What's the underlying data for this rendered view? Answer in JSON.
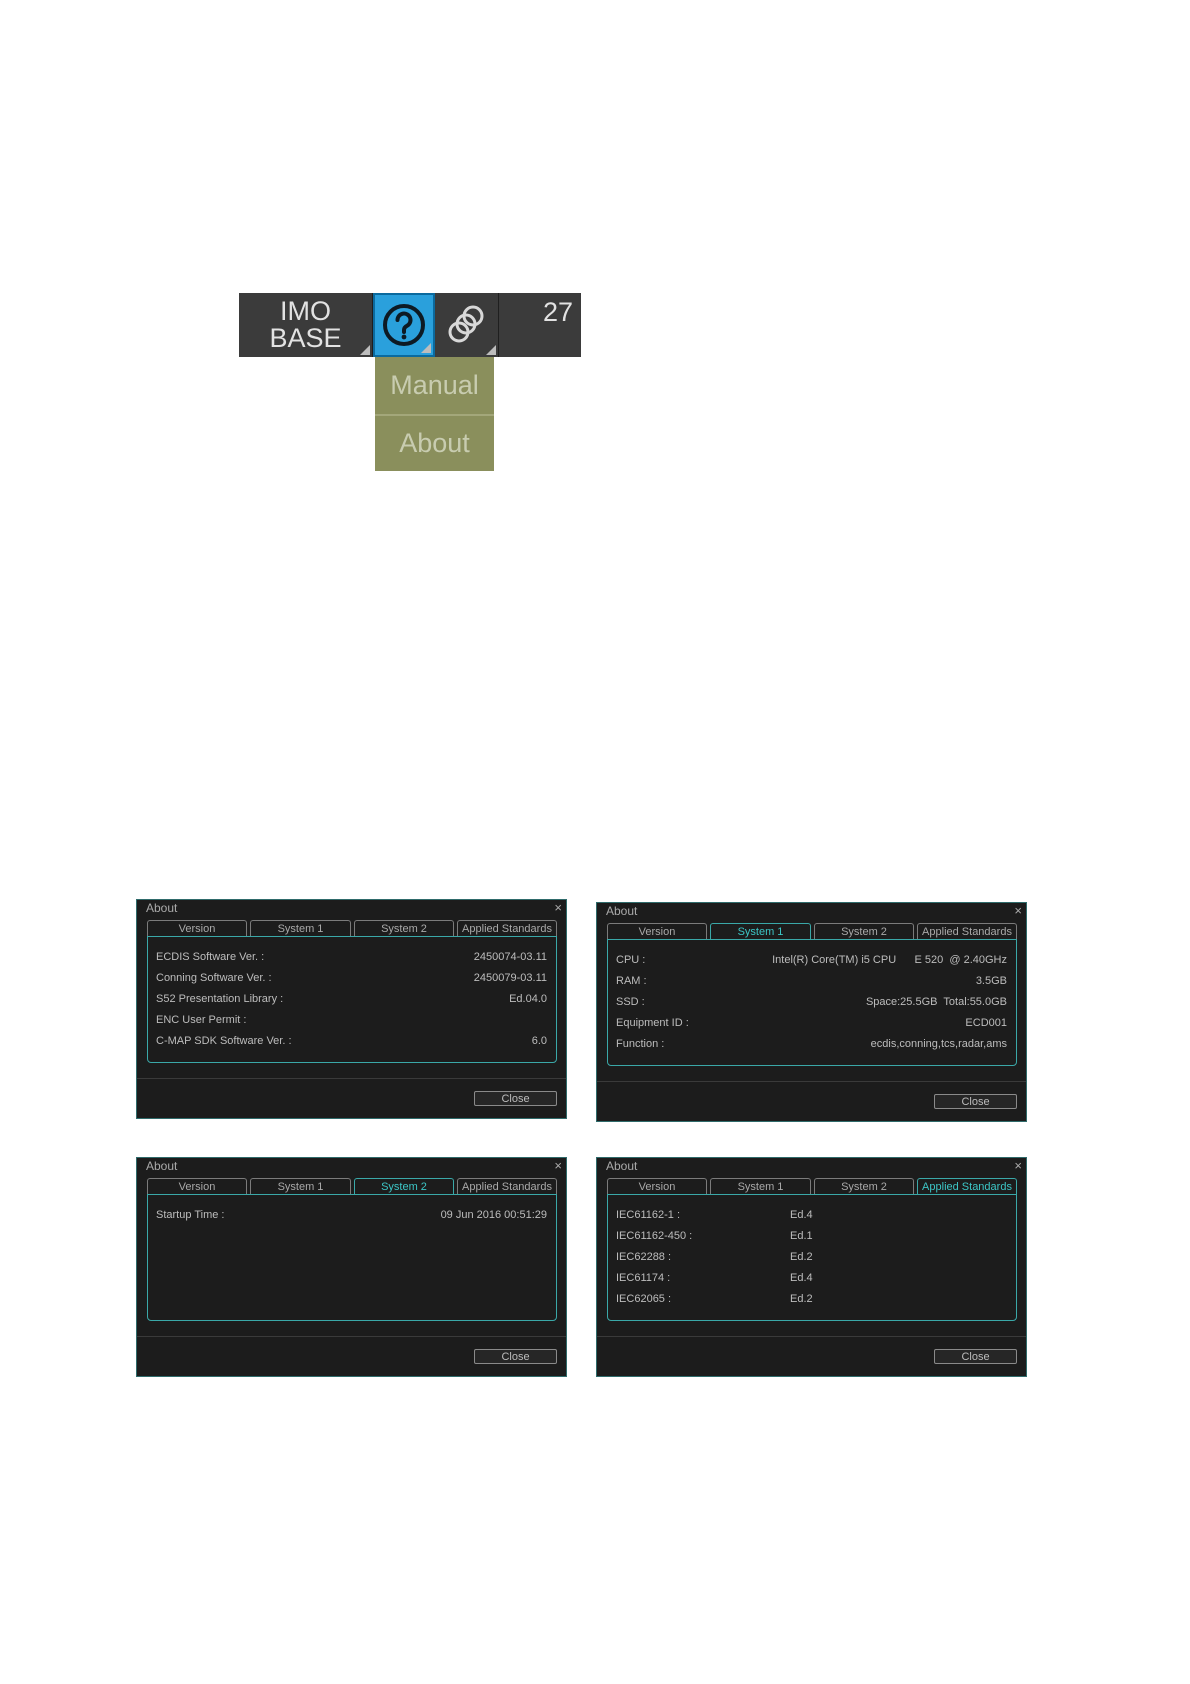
{
  "toolbar": {
    "imo_line1": "IMO",
    "imo_line2": "BASE",
    "number": "27",
    "menu": [
      "Manual",
      "About"
    ]
  },
  "dialog_common": {
    "title": "About",
    "close_x": "×",
    "tabs": [
      "Version",
      "System 1",
      "System 2",
      "Applied Standards"
    ],
    "close_button": "Close"
  },
  "dialog_version": {
    "rows": [
      {
        "label": "ECDIS Software Ver. :",
        "value": "2450074-03.11"
      },
      {
        "label": "Conning Software Ver. :",
        "value": "2450079-03.11"
      },
      {
        "label": "S52 Presentation Library :",
        "value": "Ed.04.0"
      },
      {
        "label": "ENC User Permit :",
        "value": ""
      },
      {
        "label": "C-MAP SDK Software Ver. :",
        "value": "6.0"
      }
    ]
  },
  "dialog_system1": {
    "rows": [
      {
        "label": "CPU :",
        "value": "Intel(R) Core(TM) i5 CPU      E 520  @ 2.40GHz"
      },
      {
        "label": "RAM :",
        "value": "3.5GB"
      },
      {
        "label": "SSD :",
        "value": "Space:25.5GB  Total:55.0GB"
      },
      {
        "label": "Equipment ID :",
        "value": "ECD001"
      },
      {
        "label": "Function :",
        "value": "ecdis,conning,tcs,radar,ams"
      }
    ]
  },
  "dialog_system2": {
    "rows": [
      {
        "label": "Startup Time :",
        "value": "09 Jun 2016 00:51:29"
      }
    ]
  },
  "dialog_standards": {
    "rows": [
      {
        "label": "IEC61162-1 :",
        "value": "Ed.4"
      },
      {
        "label": "IEC61162-450 :",
        "value": "Ed.1"
      },
      {
        "label": "IEC62288 :",
        "value": "Ed.2"
      },
      {
        "label": "IEC61174 :",
        "value": "Ed.4"
      },
      {
        "label": "IEC62065 :",
        "value": "Ed.2"
      }
    ]
  }
}
